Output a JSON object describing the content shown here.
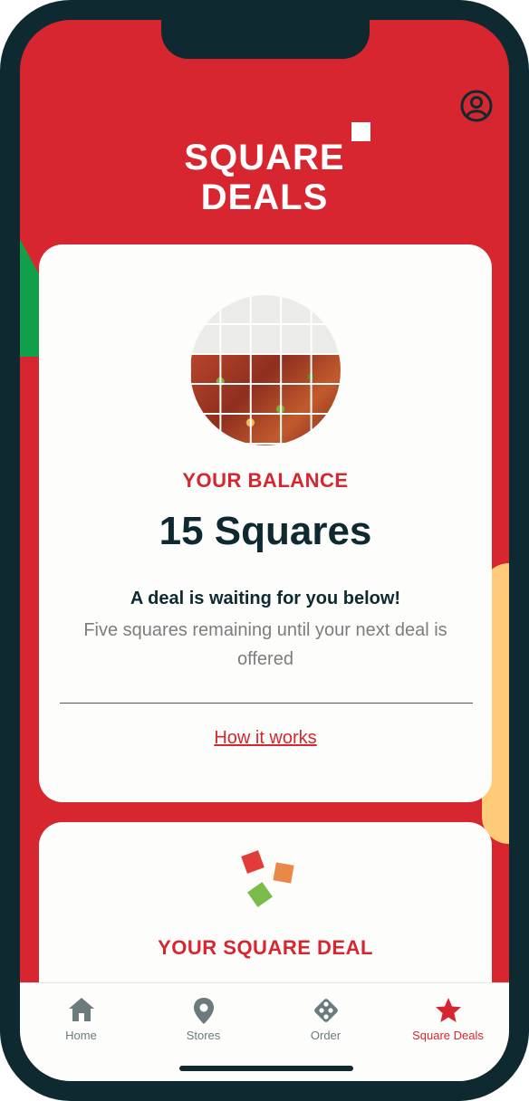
{
  "brand": {
    "line1": "SQUARE",
    "line2": "DEALS"
  },
  "balance": {
    "label": "YOUR BALANCE",
    "value": "15 Squares",
    "headline": "A deal is waiting for you below!",
    "subtext": "Five squares remaining until your next deal is offered",
    "how_link": "How it works"
  },
  "deal": {
    "title": "YOUR SQUARE DEAL"
  },
  "tabs": [
    {
      "label": "Home",
      "icon": "home-icon"
    },
    {
      "label": "Stores",
      "icon": "location-pin-icon"
    },
    {
      "label": "Order",
      "icon": "dice-icon"
    },
    {
      "label": "Square Deals",
      "icon": "star-icon"
    }
  ],
  "colors": {
    "brand_red": "#d7262f",
    "dark": "#0e2a30",
    "muted": "#6b7a7d"
  }
}
